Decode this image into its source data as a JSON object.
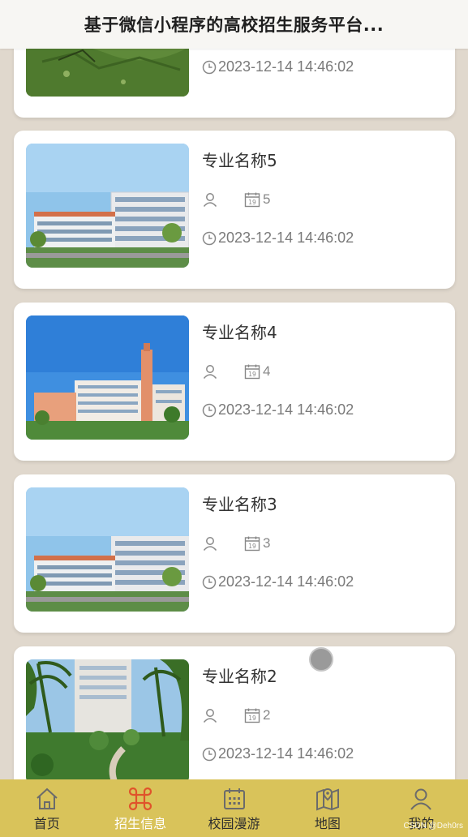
{
  "header": {
    "title": "基于微信小程序的高校招生服务平台..."
  },
  "list": {
    "items": [
      {
        "name": "",
        "views": "",
        "time": "2023-12-14 14:46:02",
        "image": "campus-lawn"
      },
      {
        "name": "专业名称5",
        "views": "5",
        "time": "2023-12-14 14:46:02",
        "image": "campus-building-white"
      },
      {
        "name": "专业名称4",
        "views": "4",
        "time": "2023-12-14 14:46:02",
        "image": "campus-building-tower"
      },
      {
        "name": "专业名称3",
        "views": "3",
        "time": "2023-12-14 14:46:02",
        "image": "campus-building-white"
      },
      {
        "name": "专业名称2",
        "views": "2",
        "time": "2023-12-14 14:46:02",
        "image": "campus-garden-palms"
      }
    ]
  },
  "tabbar": {
    "tabs": [
      {
        "label": "首页",
        "icon": "home-icon"
      },
      {
        "label": "招生信息",
        "icon": "command-icon",
        "active": true
      },
      {
        "label": "校园漫游",
        "icon": "calendar-board-icon"
      },
      {
        "label": "地图",
        "icon": "map-icon"
      },
      {
        "label": "我的",
        "icon": "user-icon"
      }
    ]
  },
  "watermark": "CSDN @Deh0rs",
  "colors": {
    "background": "#e0d8cd",
    "tabbar": "#d9c35a",
    "active_icon": "#e0532b",
    "card": "#ffffff"
  }
}
